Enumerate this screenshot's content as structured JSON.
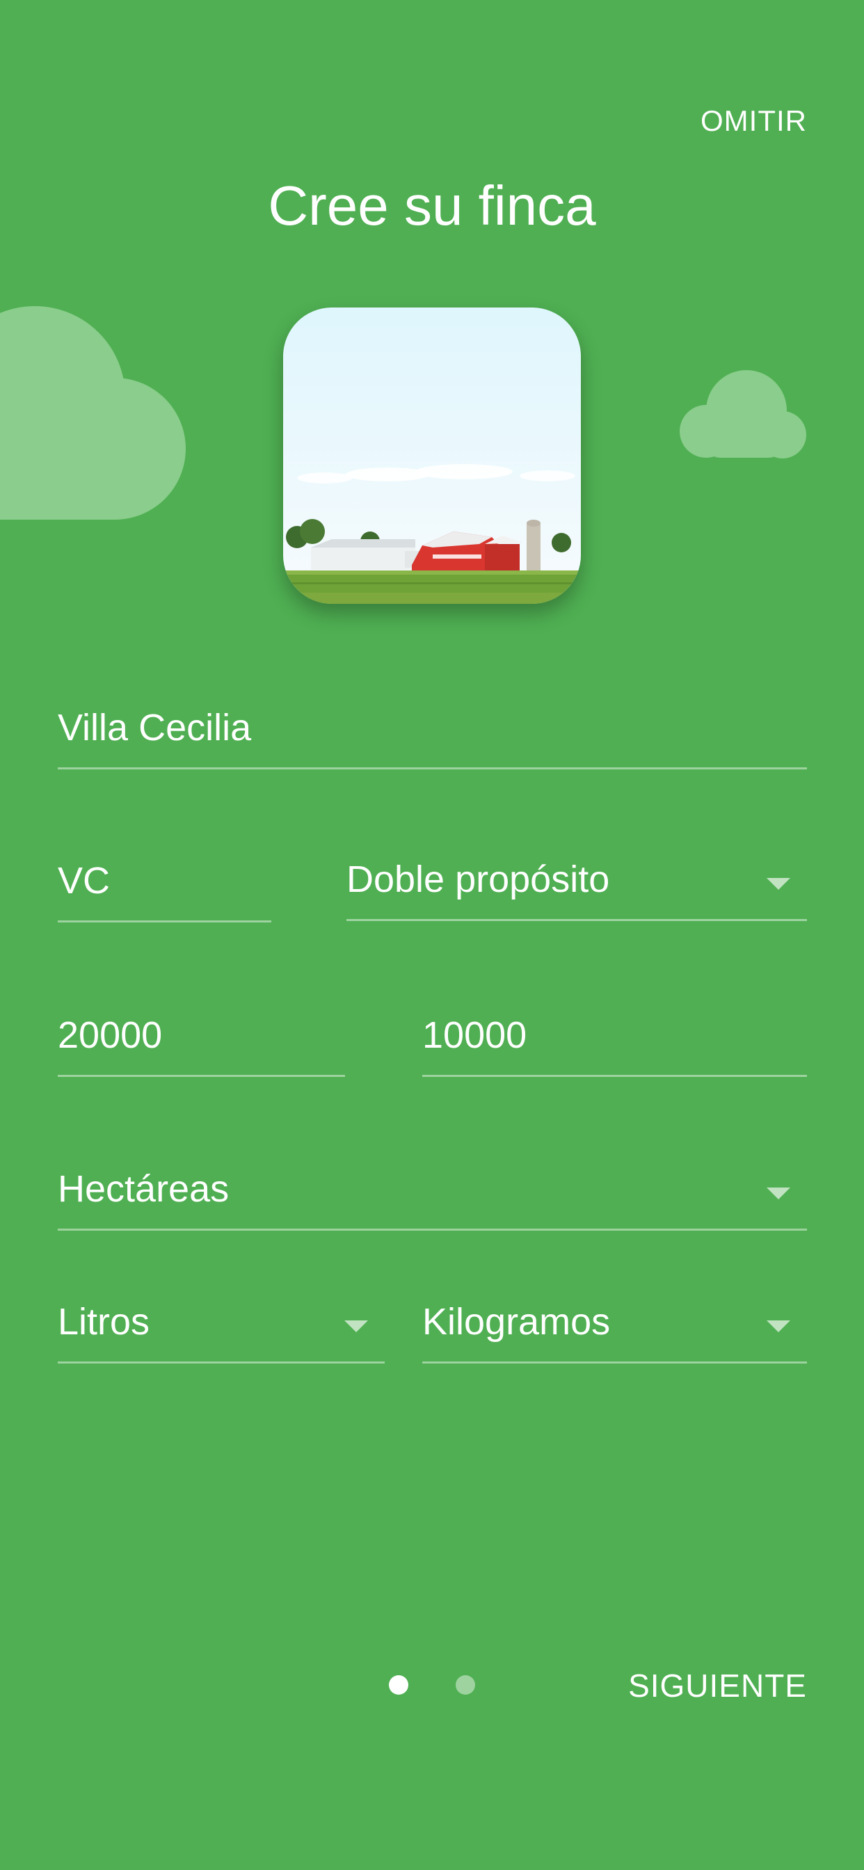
{
  "header": {
    "skip_label": "OMITIR",
    "title": "Cree su finca"
  },
  "illustration": {
    "icon": "farm-barn-photo",
    "cloud_color": "#8ACD8C"
  },
  "form": {
    "farm_name": "Villa Cecilia",
    "initials": "VC",
    "purpose": "Doble propósito",
    "value_1": "20000",
    "value_2": "10000",
    "area_unit": "Hectáreas",
    "volume_unit": "Litros",
    "weight_unit": "Kilogramos"
  },
  "pager": {
    "pages": 2,
    "current": 1
  },
  "footer": {
    "next_label": "SIGUIENTE"
  },
  "colors": {
    "background": "#4FAF52",
    "text": "#FFFFFF"
  }
}
